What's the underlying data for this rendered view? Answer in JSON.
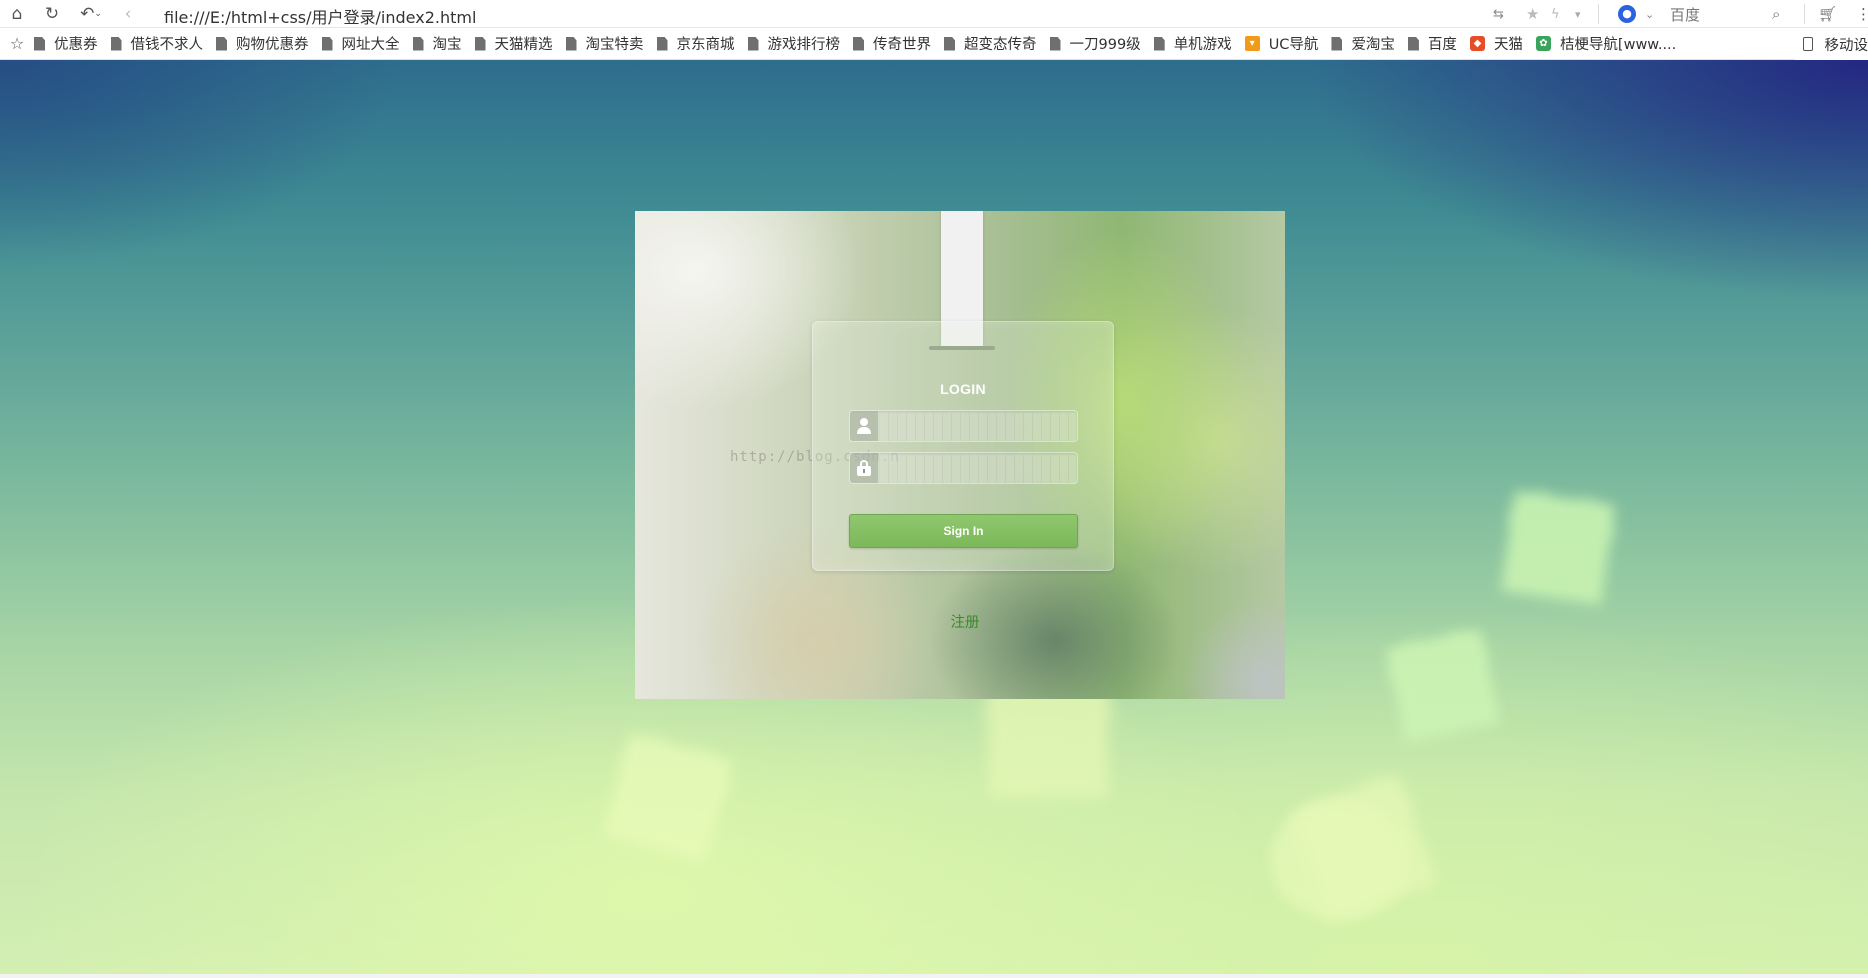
{
  "browser": {
    "url": "file:///E:/html+css/用户登录/index2.html",
    "search_engine": "百度",
    "nav_icons": [
      "home-icon",
      "refresh-icon",
      "undo-icon",
      "back-icon"
    ],
    "tool_icons": [
      "translate-icon",
      "star-icon",
      "lightning-icon",
      "baidu-paw-icon",
      "search-icon",
      "cart-icon",
      "menu-icon"
    ]
  },
  "bookmarks": {
    "items": [
      {
        "label": "优惠券",
        "icon": "page-icon"
      },
      {
        "label": "借钱不求人",
        "icon": "page-icon"
      },
      {
        "label": "购物优惠券",
        "icon": "page-icon"
      },
      {
        "label": "网址大全",
        "icon": "page-icon"
      },
      {
        "label": "淘宝",
        "icon": "page-icon"
      },
      {
        "label": "天猫精选",
        "icon": "page-icon"
      },
      {
        "label": "淘宝特卖",
        "icon": "page-icon"
      },
      {
        "label": "京东商城",
        "icon": "page-icon"
      },
      {
        "label": "游戏排行榜",
        "icon": "page-icon"
      },
      {
        "label": "传奇世界",
        "icon": "page-icon"
      },
      {
        "label": "超变态传奇",
        "icon": "page-icon"
      },
      {
        "label": "一刀999级",
        "icon": "page-icon"
      },
      {
        "label": "单机游戏",
        "icon": "page-icon"
      },
      {
        "label": "UC导航",
        "icon": "uc-icon"
      },
      {
        "label": "爱淘宝",
        "icon": "page-icon"
      },
      {
        "label": "百度",
        "icon": "page-icon"
      },
      {
        "label": "天猫",
        "icon": "tmall-icon"
      },
      {
        "label": "桔梗导航[www....",
        "icon": "jiegeng-icon"
      }
    ],
    "mobile_label": "移动设"
  },
  "login": {
    "title": "LOGIN",
    "username_value": "",
    "password_value": "",
    "signin_label": "Sign In",
    "register_label": "注册",
    "watermark": "http://blog.csdn.n",
    "accent_color": "#7cb85a",
    "register_color": "#3a8a2a"
  }
}
